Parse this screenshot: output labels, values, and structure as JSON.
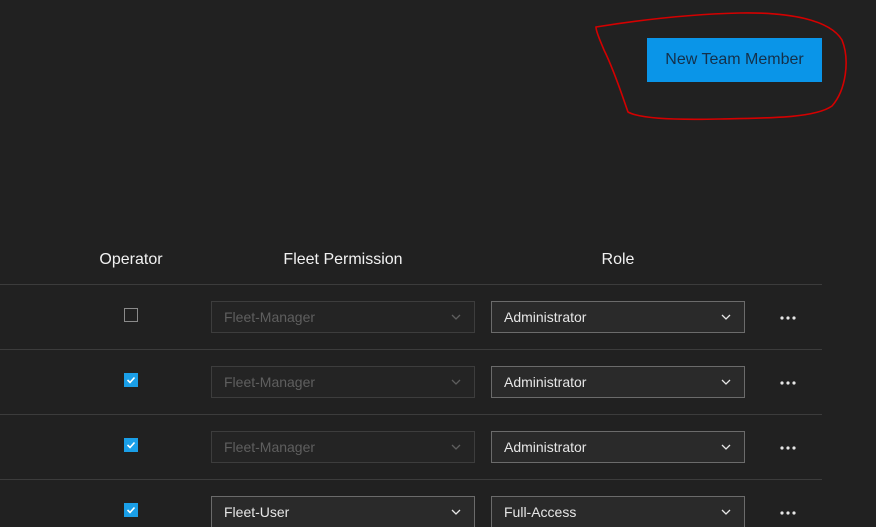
{
  "header": {
    "new_member_label": "New Team Member"
  },
  "table": {
    "columns": {
      "operator": "Operator",
      "fleet_permission": "Fleet Permission",
      "role": "Role"
    },
    "rows": [
      {
        "operator": false,
        "fleet_permission": "Fleet-Manager",
        "fleet_enabled": false,
        "role": "Administrator"
      },
      {
        "operator": true,
        "fleet_permission": "Fleet-Manager",
        "fleet_enabled": false,
        "role": "Administrator"
      },
      {
        "operator": true,
        "fleet_permission": "Fleet-Manager",
        "fleet_enabled": false,
        "role": "Administrator"
      },
      {
        "operator": true,
        "fleet_permission": "Fleet-User",
        "fleet_enabled": true,
        "role": "Full-Access"
      }
    ]
  },
  "colors": {
    "background": "#212121",
    "accent": "#0a95e8",
    "checkbox_checked": "#1a9fe8",
    "annotation": "#d40000"
  },
  "icons": {
    "select_caret": "chevron-down-icon",
    "row_actions": "more-horizontal-icon",
    "checkbox_mark": "checkmark-icon"
  }
}
